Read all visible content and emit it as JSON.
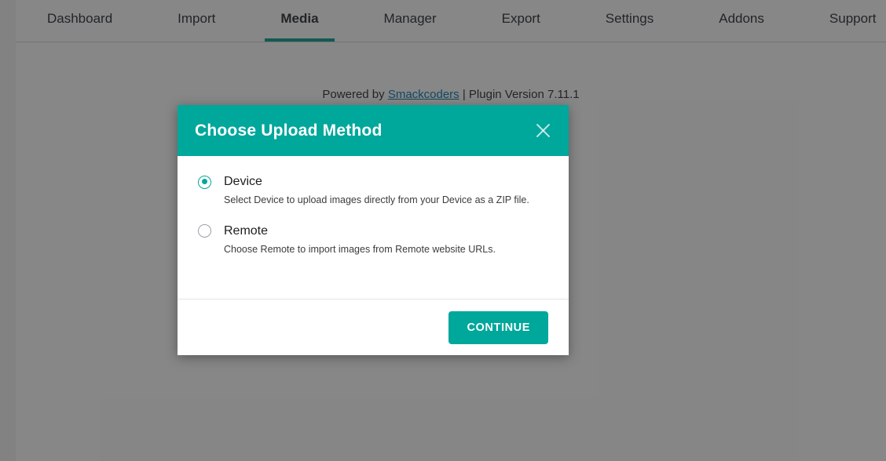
{
  "nav": {
    "tabs": [
      {
        "label": "Dashboard",
        "active": false
      },
      {
        "label": "Import",
        "active": false
      },
      {
        "label": "Media",
        "active": true
      },
      {
        "label": "Manager",
        "active": false
      },
      {
        "label": "Export",
        "active": false
      },
      {
        "label": "Settings",
        "active": false
      },
      {
        "label": "Addons",
        "active": false
      },
      {
        "label": "Support",
        "active": false
      }
    ],
    "active_tab": "Media",
    "active_underline_color": "#009688"
  },
  "footer_note": {
    "prefix": "Powered by ",
    "link_text": "Smackcoders",
    "suffix": " | Plugin Version 7.11.1",
    "link_color": "#0073aa"
  },
  "dialog": {
    "title": "Choose Upload Method",
    "header_color": "#00a79b",
    "close_icon": "close-icon",
    "options": [
      {
        "id": "device",
        "label": "Device",
        "description": "Select Device to upload images directly from your Device as a ZIP file.",
        "selected": true
      },
      {
        "id": "remote",
        "label": "Remote",
        "description": "Choose Remote to import images from Remote website URLs.",
        "selected": false
      }
    ],
    "continue_label": "CONTINUE",
    "accent_color": "#00a79b"
  },
  "overlay": {
    "color": "rgba(34, 34, 34, 0.52)"
  }
}
